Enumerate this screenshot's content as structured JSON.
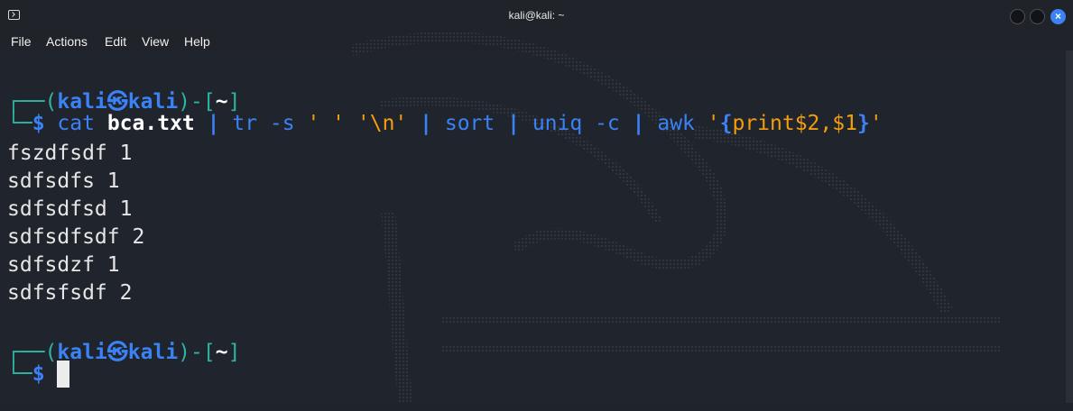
{
  "window": {
    "title": "kali@kali: ~",
    "close_glyph": "×"
  },
  "menu": [
    "File",
    "Actions",
    "Edit",
    "View",
    "Help"
  ],
  "prompt": {
    "corner_top": "┌──(",
    "user": "kali",
    "at_symbol": "㉿",
    "host": "kali",
    "mid": ")-[",
    "path": "~",
    "end": "]",
    "corner_bottom": "└─",
    "dollar": "$"
  },
  "command": {
    "cmd": "cat",
    "file": "bca.txt",
    "pipe": "|",
    "tr": "tr",
    "tr_args": "-s",
    "tr_q1": "' '",
    "tr_q2": "'\\n'",
    "sort": "sort",
    "uniq": "uniq",
    "uniq_args": "-c",
    "awk": "awk",
    "awk_q_open": "'",
    "awk_brace_open": "{",
    "awk_body": "print$2,$1",
    "awk_brace_close": "}",
    "awk_q_close": "'"
  },
  "output": [
    "fszdfsdf 1",
    "sdfsdfs 1",
    "sdfsdfsd 1",
    "sdfsdfsdf 2",
    "sdfsdzf 1",
    "sdfsfsdf 2"
  ],
  "colors": {
    "background": "#20242c",
    "prompt_green": "#2fb3a2",
    "prompt_blue": "#3b82f6",
    "string_orange": "#f59e0b"
  }
}
